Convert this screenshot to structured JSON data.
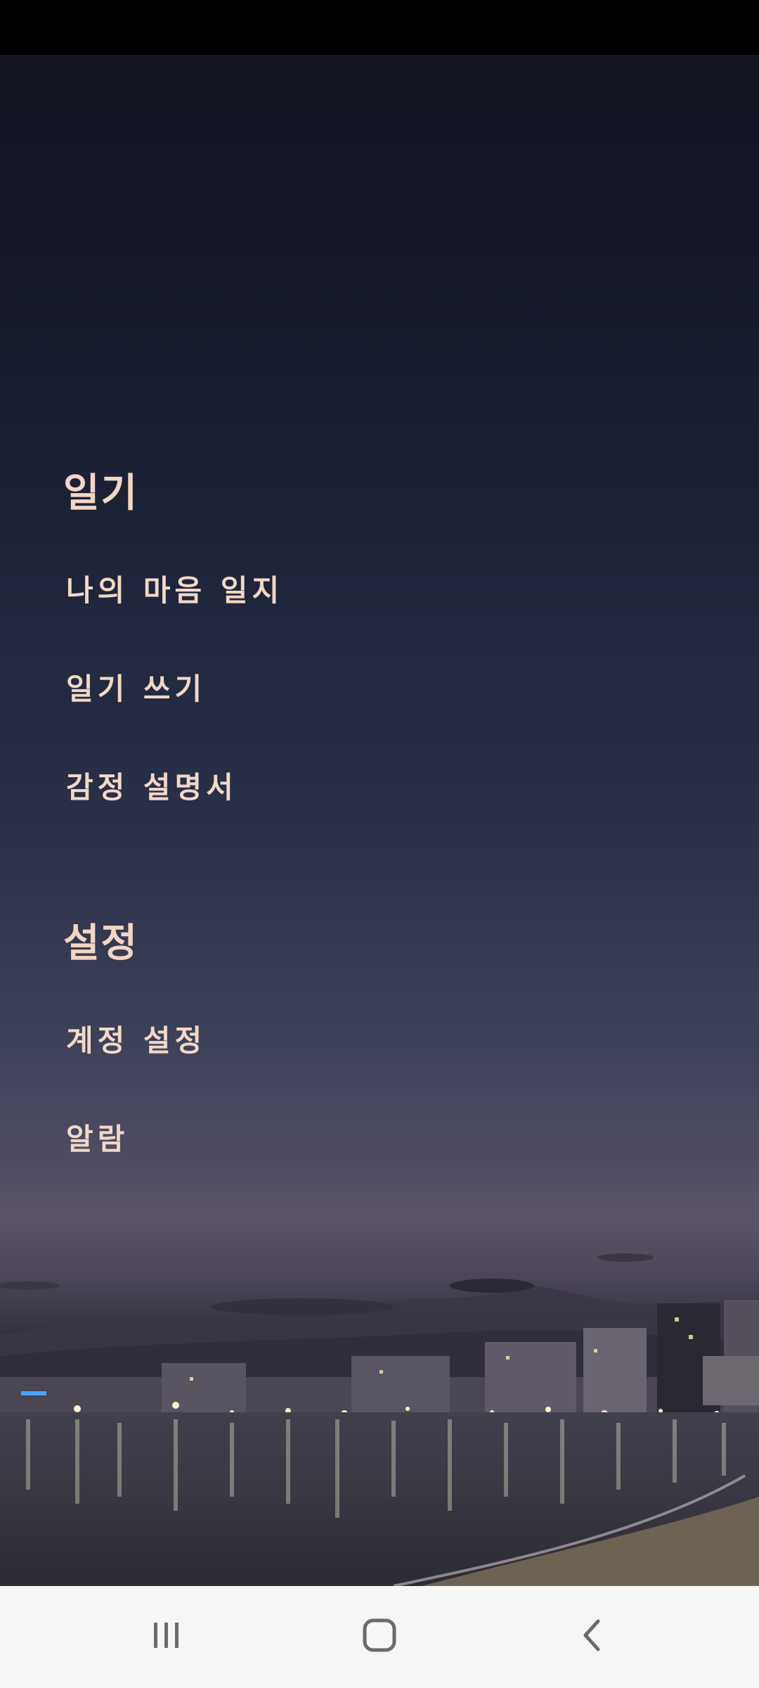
{
  "menu": {
    "sections": [
      {
        "title": "일기",
        "items": [
          "나의 마음 일지",
          "일기 쓰기",
          "감정 설명서"
        ]
      },
      {
        "title": "설정",
        "items": [
          "계정 설정",
          "알람"
        ]
      }
    ]
  },
  "colors": {
    "menu_text": "#f1d8c8",
    "nav_bar_bg": "#f6f6f6",
    "nav_icon": "#6b6b6b"
  },
  "nav_bar": {
    "icons": [
      "recent-apps-icon",
      "home-icon",
      "back-icon"
    ]
  }
}
